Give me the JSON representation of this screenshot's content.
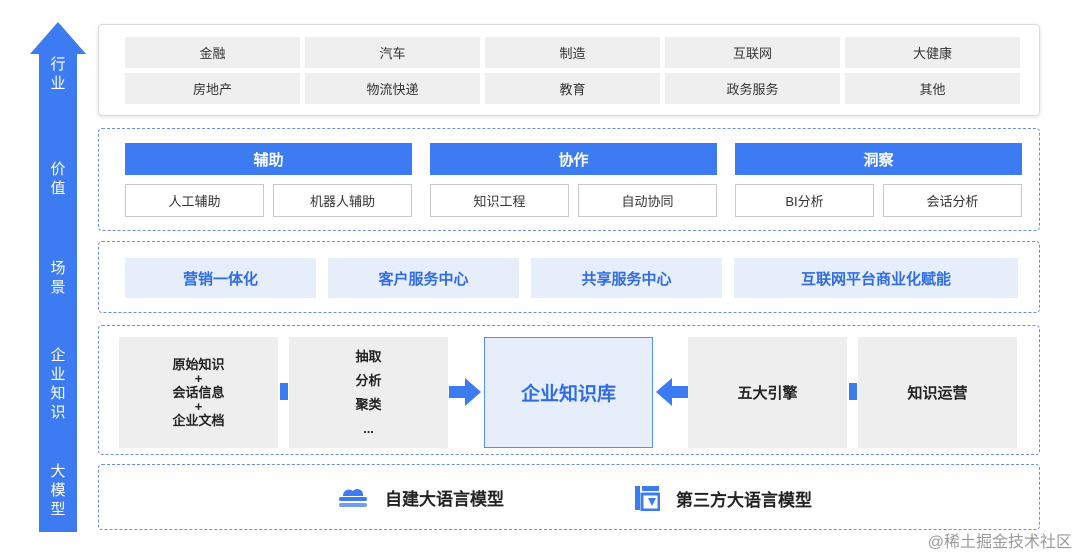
{
  "side_labels": {
    "industry": "行\n业",
    "value": "价\n值",
    "scene": "场\n景",
    "enterprise": "企\n业\n知\n识",
    "llm": "大\n模\n型"
  },
  "industries": [
    "金融",
    "汽车",
    "制造",
    "互联网",
    "大健康",
    "房地产",
    "物流快递",
    "教育",
    "政务服务",
    "其他"
  ],
  "value": {
    "groups": [
      {
        "title": "辅助",
        "items": [
          "人工辅助",
          "机器人辅助"
        ]
      },
      {
        "title": "协作",
        "items": [
          "知识工程",
          "自动协同"
        ]
      },
      {
        "title": "洞察",
        "items": [
          "BI分析",
          "会话分析"
        ]
      }
    ]
  },
  "scenes": [
    "营销一体化",
    "客户服务中心",
    "共享服务中心",
    "互联网平台商业化赋能"
  ],
  "enterprise": {
    "sources": [
      "原始知识",
      "+",
      "会话信息",
      "+",
      "企业文档"
    ],
    "steps": [
      "抽取",
      "分析",
      "聚类",
      "..."
    ],
    "center": "企业知识库",
    "engine": "五大引擎",
    "ops": "知识运营"
  },
  "llm": {
    "self_built": "自建大语言模型",
    "third_party": "第三方大语言模型"
  },
  "watermark": "@稀土掘金技术社区",
  "colors": {
    "accent": "#3d7bf3",
    "accent_light": "#e6eefc",
    "gray_cell": "#efefef",
    "border_dashed": "#6c8fe0"
  }
}
